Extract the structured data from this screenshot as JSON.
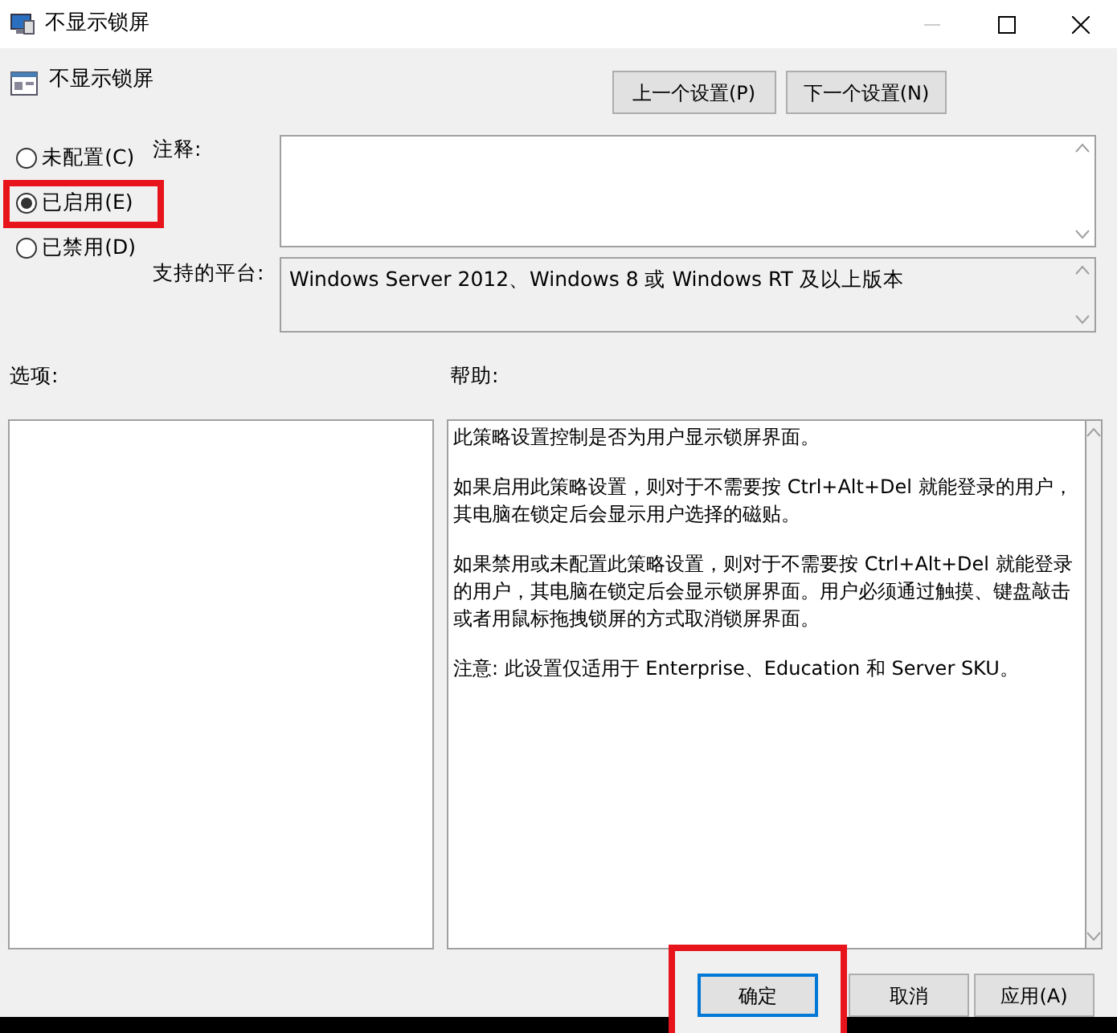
{
  "window": {
    "title": "不显示锁屏"
  },
  "policy": {
    "name": "不显示锁屏"
  },
  "nav_buttons": [
    "上一个设置(P)",
    "下一个设置(N)"
  ],
  "options": [
    {
      "label": "未配置(C)",
      "selected": false,
      "highlighted": false
    },
    {
      "label": "已启用(E)",
      "selected": true,
      "highlighted": true
    },
    {
      "label": "已禁用(D)",
      "selected": false,
      "highlighted": false
    }
  ],
  "comment": {
    "label": "注释:"
  },
  "platform": {
    "label": "支持的平台:",
    "value": "Windows Server 2012、Windows 8 或 Windows RT 及以上版本"
  },
  "options_label": "选项:",
  "help_label": "帮助:",
  "help_paragraphs": [
    "此策略设置控制是否为用户显示锁屏界面。",
    "如果启用此策略设置，则对于不需要按 Ctrl+Alt+Del 就能登录的用户，其电脑在锁定后会显示用户选择的磁贴。",
    "如果禁用或未配置此策略设置，则对于不需要按 Ctrl+Alt+Del 就能登录的用户，其电脑在锁定后会显示锁屏界面。用户必须通过触摸、键盘敲击或者用鼠标拖拽锁屏的方式取消锁屏界面。",
    "注意: 此设置仅适用于 Enterprise、Education 和 Server SKU。"
  ],
  "footer_buttons": [
    {
      "label": "确定",
      "highlighted": true,
      "default": true
    },
    {
      "label": "取消",
      "highlighted": false,
      "default": false
    },
    {
      "label": "应用(A)",
      "highlighted": false,
      "default": false
    }
  ]
}
